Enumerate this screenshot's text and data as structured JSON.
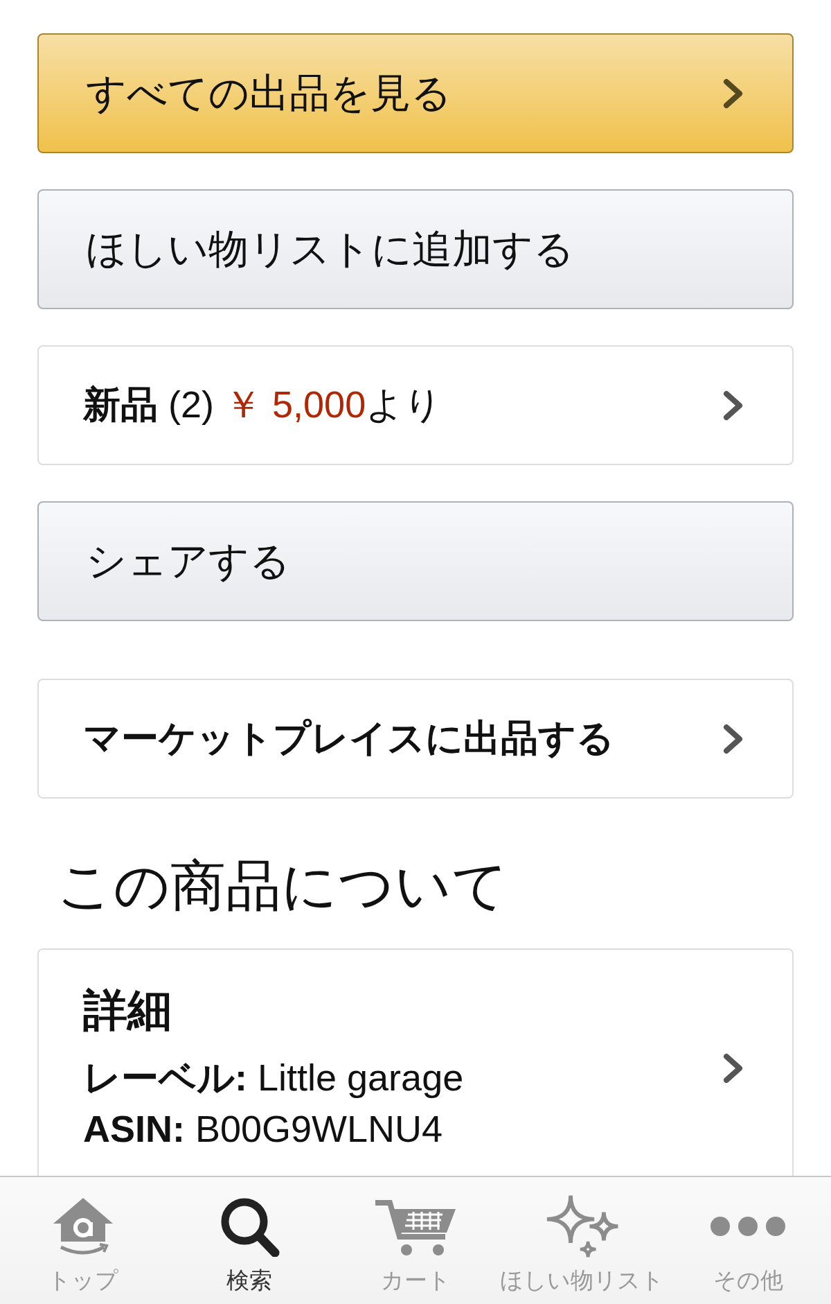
{
  "actions": [
    {
      "kind": "primary",
      "label": "すべての出品を見る"
    },
    {
      "kind": "secondary",
      "label": "ほしい物リストに追加する"
    },
    {
      "kind": "offer",
      "condition": "新品",
      "count": "(2)",
      "price": "￥ 5,000",
      "suffix": "より"
    },
    {
      "kind": "secondary",
      "label": "シェアする"
    },
    {
      "kind": "link",
      "label": "マーケットプレイスに出品する"
    }
  ],
  "about": {
    "heading": "この商品について",
    "details": {
      "title": "詳細",
      "lines": [
        "**レーベル:** Little garage",
        "**ASIN:** B00G9WLNU4"
      ]
    }
  },
  "tab_bar": {
    "tabs": [
      {
        "kind": "home",
        "label": "トップ",
        "selected": false
      },
      {
        "kind": "search",
        "label": "検索",
        "selected": true
      },
      {
        "kind": "cart",
        "label": "カート",
        "selected": false
      },
      {
        "kind": "wishlist",
        "label": "ほしい物リスト",
        "selected": false
      },
      {
        "kind": "more",
        "label": "その他",
        "selected": false
      }
    ]
  }
}
